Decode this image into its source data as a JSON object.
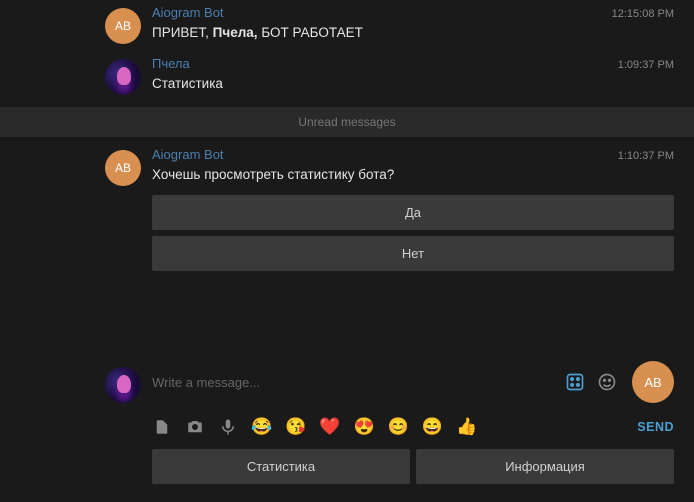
{
  "messages": [
    {
      "sender": "Aiogram Bot",
      "avatar_text": "AB",
      "avatar_kind": "bot",
      "time": "12:15:08 PM",
      "text_pre": "ПРИВЕТ, ",
      "text_bold": "Пчела,",
      "text_post": " БОТ РАБОТАЕТ"
    },
    {
      "sender": "Пчела",
      "avatar_kind": "user",
      "time": "1:09:37 PM",
      "text": "Статистика"
    }
  ],
  "divider": "Unread messages",
  "unread": {
    "sender": "Aiogram Bot",
    "avatar_text": "AB",
    "time": "1:10:37 PM",
    "text": "Хочешь просмотреть статистику бота?",
    "buttons": [
      "Да",
      "Нет"
    ]
  },
  "composer": {
    "placeholder": "Write a message...",
    "preview_avatar_text": "AB",
    "send_label": "SEND"
  },
  "emojis": [
    "😂",
    "😘",
    "❤️",
    "😍",
    "😊",
    "😄",
    "👍"
  ],
  "keyboard": [
    "Статистика",
    "Информация"
  ]
}
